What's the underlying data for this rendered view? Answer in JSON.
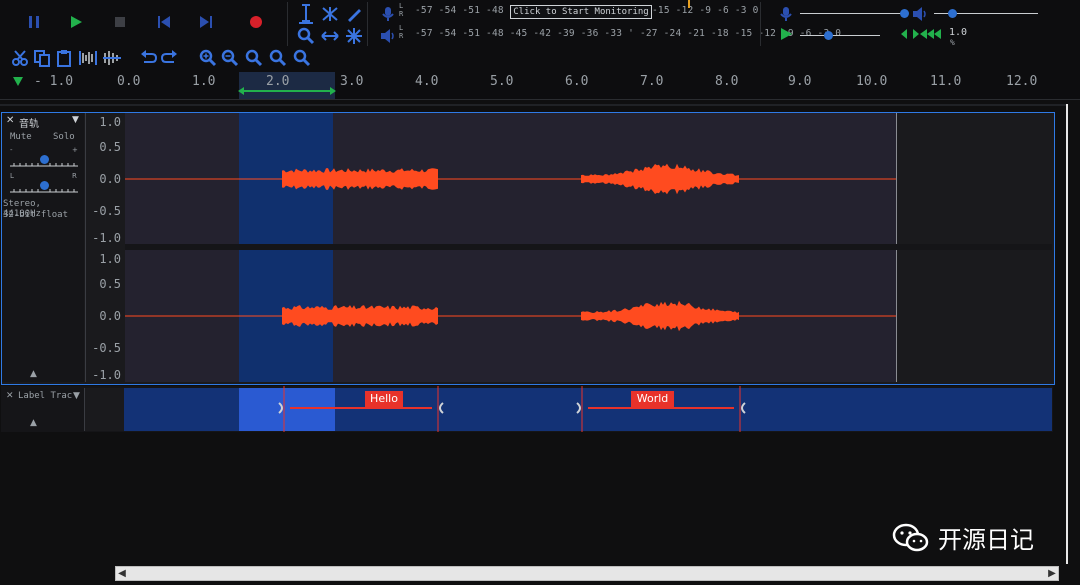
{
  "transport": {
    "pause_icon": "pause-icon",
    "play_icon": "play-icon",
    "stop_icon": "stop-icon",
    "skip_start_icon": "skip-start-icon",
    "skip_end_icon": "skip-end-icon",
    "record_icon": "record-icon"
  },
  "meters": {
    "record_scale": "-57 -54 -51 -48 -45 -",
    "record_scale_tail": "-15 -12  -9  -6  -3  0",
    "monitor_label": "Click to Start Monitoring",
    "play_scale": "-57 -54 -51 -48 -45 -42 -39 -36 -33  ' -27 -24 -21 -18 -15 -12  -9  -6  -3  0",
    "record_lr": "L\nR",
    "play_lr": "L\nR"
  },
  "playback_speed": {
    "value": "1.0",
    "sublabel": "%"
  },
  "ruler": {
    "labels": [
      "- 1.0",
      "0.0",
      "1.0",
      "2.0",
      "3.0",
      "4.0",
      "5.0",
      "6.0",
      "7.0",
      "8.0",
      "9.0",
      "10.0",
      "11.0",
      "12.0"
    ]
  },
  "audio_track": {
    "name": "音轨",
    "mute": "Mute",
    "solo": "Solo",
    "gain_minus": "-",
    "gain_plus": "+",
    "pan_left": "L",
    "pan_right": "R",
    "info_line1": "Stereo, 44100Hz",
    "info_line2": "32-bit float",
    "close": "✕",
    "menu_arrow": "▼",
    "collapse": "▲",
    "scale_top": [
      "1.0",
      "0.5",
      "0.0",
      "-0.5",
      "-1.0"
    ],
    "scale_bottom": [
      "1.0",
      "0.5",
      "0.0",
      "-0.5",
      "-1.0"
    ]
  },
  "label_track": {
    "name": "Label Trac",
    "close": "✕",
    "menu_arrow": "▼",
    "collapse": "▲",
    "labels": [
      "Hello",
      "World"
    ]
  },
  "scrollbar": {
    "left": "◀",
    "right": "▶"
  },
  "watermark": {
    "text": "开源日记"
  },
  "colors": {
    "accent": "#2f7ae5",
    "waveform": "#ff4b1f",
    "label_red": "#e8322a",
    "selection": "#10306e"
  }
}
